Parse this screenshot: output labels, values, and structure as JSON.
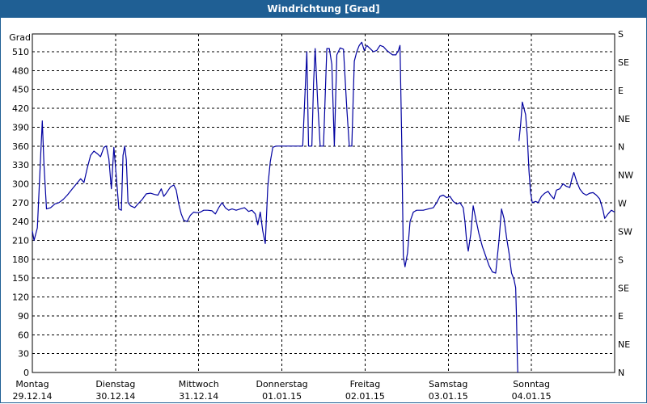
{
  "window": {
    "title": "Windrichtung [Grad]"
  },
  "chart_data": {
    "type": "line",
    "title": "Windrichtung [Grad]",
    "ylabel": "Grad",
    "ylim": [
      0,
      525
    ],
    "y_ticks": [
      0,
      30,
      60,
      90,
      120,
      150,
      180,
      210,
      240,
      270,
      300,
      330,
      360,
      390,
      420,
      450,
      480,
      510
    ],
    "y2_ticks": [
      {
        "value": 0,
        "label": "N"
      },
      {
        "value": 45,
        "label": "NE"
      },
      {
        "value": 90,
        "label": "E"
      },
      {
        "value": 135,
        "label": "SE"
      },
      {
        "value": 180,
        "label": "S"
      },
      {
        "value": 225,
        "label": "SW"
      },
      {
        "value": 270,
        "label": "W"
      },
      {
        "value": 315,
        "label": "NW"
      },
      {
        "value": 360,
        "label": "N"
      },
      {
        "value": 405,
        "label": "NE"
      },
      {
        "value": 450,
        "label": "E"
      },
      {
        "value": 495,
        "label": "SE"
      },
      {
        "value": 540,
        "label": "S"
      }
    ],
    "xlim": [
      0,
      7
    ],
    "x_ticks": [
      {
        "day": "Montag",
        "date": "29.12.14"
      },
      {
        "day": "Dienstag",
        "date": "30.12.14"
      },
      {
        "day": "Mittwoch",
        "date": "31.12.14"
      },
      {
        "day": "Donnerstag",
        "date": "01.01.15"
      },
      {
        "day": "Freitag",
        "date": "02.01.15"
      },
      {
        "day": "Samstag",
        "date": "03.01.15"
      },
      {
        "day": "Sonntag",
        "date": "04.01.15"
      }
    ],
    "grid": true,
    "series": [
      {
        "color": "#0000a0",
        "segments": [
          [
            [
              0.0,
              225
            ],
            [
              0.02,
              210
            ],
            [
              0.06,
              230
            ],
            [
              0.1,
              345
            ],
            [
              0.12,
              400
            ],
            [
              0.14,
              330
            ],
            [
              0.17,
              260
            ],
            [
              0.22,
              262
            ],
            [
              0.27,
              268
            ],
            [
              0.32,
              270
            ],
            [
              0.37,
              275
            ],
            [
              0.42,
              282
            ],
            [
              0.48,
              292
            ],
            [
              0.53,
              300
            ],
            [
              0.58,
              308
            ],
            [
              0.62,
              302
            ],
            [
              0.66,
              325
            ],
            [
              0.7,
              345
            ],
            [
              0.74,
              352
            ],
            [
              0.78,
              348
            ],
            [
              0.82,
              343
            ],
            [
              0.86,
              358
            ],
            [
              0.89,
              360
            ],
            [
              0.92,
              340
            ],
            [
              0.95,
              292
            ],
            [
              0.98,
              358
            ],
            [
              1.01,
              310
            ],
            [
              1.04,
              260
            ],
            [
              1.07,
              258
            ],
            [
              1.09,
              345
            ],
            [
              1.11,
              360
            ],
            [
              1.13,
              338
            ],
            [
              1.15,
              270
            ],
            [
              1.18,
              265
            ],
            [
              1.23,
              262
            ],
            [
              1.27,
              268
            ],
            [
              1.32,
              275
            ],
            [
              1.37,
              284
            ],
            [
              1.42,
              285
            ],
            [
              1.47,
              283
            ],
            [
              1.51,
              282
            ],
            [
              1.55,
              292
            ],
            [
              1.58,
              280
            ],
            [
              1.61,
              285
            ],
            [
              1.66,
              295
            ],
            [
              1.7,
              298
            ],
            [
              1.73,
              290
            ],
            [
              1.76,
              268
            ],
            [
              1.79,
              252
            ],
            [
              1.82,
              242
            ],
            [
              1.86,
              240
            ],
            [
              1.9,
              250
            ],
            [
              1.94,
              255
            ],
            [
              1.98,
              254
            ],
            [
              2.02,
              255
            ],
            [
              2.06,
              258
            ],
            [
              2.11,
              258
            ],
            [
              2.16,
              257
            ],
            [
              2.2,
              252
            ],
            [
              2.24,
              262
            ],
            [
              2.28,
              270
            ],
            [
              2.32,
              262
            ],
            [
              2.36,
              258
            ],
            [
              2.4,
              260
            ],
            [
              2.45,
              258
            ],
            [
              2.5,
              260
            ],
            [
              2.55,
              262
            ],
            [
              2.6,
              256
            ],
            [
              2.64,
              258
            ],
            [
              2.68,
              252
            ],
            [
              2.71,
              235
            ],
            [
              2.74,
              255
            ],
            [
              2.77,
              225
            ],
            [
              2.8,
              205
            ],
            [
              2.83,
              295
            ],
            [
              2.86,
              335
            ],
            [
              2.89,
              358
            ],
            [
              2.93,
              360
            ],
            [
              3.0,
              360
            ],
            [
              3.1,
              360
            ],
            [
              3.2,
              360
            ],
            [
              3.25,
              360
            ],
            [
              3.3,
              510
            ],
            [
              3.32,
              360
            ],
            [
              3.36,
              360
            ],
            [
              3.38,
              460
            ],
            [
              3.4,
              515
            ],
            [
              3.43,
              430
            ],
            [
              3.46,
              360
            ],
            [
              3.5,
              360
            ],
            [
              3.54,
              515
            ],
            [
              3.57,
              515
            ],
            [
              3.6,
              490
            ],
            [
              3.63,
              360
            ],
            [
              3.66,
              505
            ],
            [
              3.7,
              516
            ],
            [
              3.74,
              514
            ],
            [
              3.78,
              420
            ],
            [
              3.81,
              360
            ],
            [
              3.84,
              360
            ],
            [
              3.87,
              495
            ],
            [
              3.9,
              510
            ],
            [
              3.93,
              520
            ],
            [
              3.96,
              525
            ],
            [
              3.99,
              512
            ],
            [
              4.02,
              520
            ],
            [
              4.06,
              515
            ],
            [
              4.1,
              510
            ],
            [
              4.14,
              512
            ],
            [
              4.18,
              520
            ],
            [
              4.22,
              518
            ],
            [
              4.26,
              512
            ],
            [
              4.3,
              508
            ],
            [
              4.33,
              505
            ],
            [
              4.37,
              505
            ],
            [
              4.4,
              512
            ],
            [
              4.42,
              520
            ],
            [
              4.44,
              370
            ],
            [
              4.46,
              185
            ],
            [
              4.48,
              168
            ],
            [
              4.51,
              190
            ],
            [
              4.54,
              240
            ],
            [
              4.58,
              255
            ],
            [
              4.62,
              258
            ],
            [
              4.7,
              258
            ],
            [
              4.76,
              260
            ],
            [
              4.82,
              262
            ],
            [
              4.86,
              270
            ],
            [
              4.9,
              280
            ],
            [
              4.94,
              282
            ],
            [
              4.98,
              278
            ],
            [
              5.02,
              280
            ],
            [
              5.06,
              272
            ],
            [
              5.1,
              268
            ],
            [
              5.14,
              270
            ],
            [
              5.18,
              262
            ],
            [
              5.2,
              240
            ],
            [
              5.22,
              210
            ],
            [
              5.24,
              193
            ],
            [
              5.27,
              220
            ],
            [
              5.3,
              265
            ],
            [
              5.33,
              245
            ],
            [
              5.37,
              220
            ],
            [
              5.41,
              200
            ],
            [
              5.45,
              185
            ],
            [
              5.49,
              170
            ],
            [
              5.53,
              160
            ],
            [
              5.57,
              158
            ],
            [
              5.61,
              210
            ],
            [
              5.64,
              260
            ],
            [
              5.67,
              245
            ],
            [
              5.7,
              215
            ],
            [
              5.73,
              190
            ],
            [
              5.76,
              158
            ],
            [
              5.79,
              148
            ],
            [
              5.81,
              135
            ],
            [
              5.82,
              90
            ],
            [
              5.83,
              20
            ],
            [
              5.835,
              0
            ]
          ],
          [
            [
              5.85,
              368
            ],
            [
              5.87,
              395
            ],
            [
              5.89,
              430
            ],
            [
              5.91,
              420
            ],
            [
              5.93,
              410
            ],
            [
              5.95,
              375
            ],
            [
              5.97,
              320
            ],
            [
              5.99,
              285
            ],
            [
              6.01,
              270
            ],
            [
              6.05,
              272
            ],
            [
              6.08,
              270
            ],
            [
              6.12,
              280
            ],
            [
              6.16,
              285
            ],
            [
              6.2,
              288
            ],
            [
              6.23,
              282
            ],
            [
              6.27,
              276
            ],
            [
              6.3,
              290
            ],
            [
              6.34,
              292
            ],
            [
              6.38,
              300
            ],
            [
              6.42,
              296
            ],
            [
              6.46,
              294
            ],
            [
              6.49,
              310
            ],
            [
              6.51,
              318
            ],
            [
              6.54,
              305
            ],
            [
              6.58,
              292
            ],
            [
              6.62,
              285
            ],
            [
              6.66,
              282
            ],
            [
              6.7,
              285
            ],
            [
              6.74,
              286
            ],
            [
              6.78,
              282
            ],
            [
              6.82,
              276
            ],
            [
              6.86,
              258
            ],
            [
              6.88,
              245
            ],
            [
              6.92,
              252
            ],
            [
              6.96,
              258
            ],
            [
              7.0,
              255
            ]
          ]
        ]
      }
    ]
  }
}
